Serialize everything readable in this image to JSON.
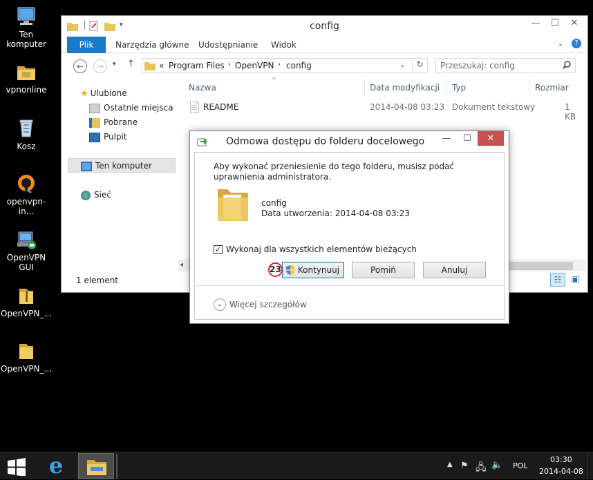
{
  "desktop": {
    "icons": [
      {
        "label": "Ten komputer"
      },
      {
        "label": "vpnonline"
      },
      {
        "label": "Kosz"
      },
      {
        "label": "openvpn-in..."
      },
      {
        "label": "OpenVPN GUI"
      },
      {
        "label": "OpenVPN_..."
      },
      {
        "label": "OpenVPN_..."
      }
    ]
  },
  "explorer": {
    "title": "config",
    "ribbon_tabs": [
      "Plik",
      "Narzędzia główne",
      "Udostępnianie",
      "Widok"
    ],
    "address": {
      "prefix": "«",
      "parts": [
        "Program Files",
        "OpenVPN",
        "config"
      ]
    },
    "search_placeholder": "Przeszukaj: config",
    "nav": {
      "favorites": "Ulubione",
      "fav_items": [
        "Ostatnie miejsca",
        "Pobrane",
        "Pulpit"
      ],
      "this_pc": "Ten komputer",
      "network": "Sieć"
    },
    "columns": [
      "Nazwa",
      "Data modyfikacji",
      "Typ",
      "Rozmiar"
    ],
    "files": [
      {
        "name": "README",
        "modified": "2014-04-08 03:23",
        "type": "Dokument tekstowy",
        "size": "1 KB"
      }
    ],
    "status": "1 element"
  },
  "dialog": {
    "title": "Odmowa dostępu do folderu docelowego",
    "message": "Aby wykonać przeniesienie do tego folderu, musisz podać uprawnienia administratora.",
    "item_name": "config",
    "item_date": "Data utworzenia: 2014-04-08 03:23",
    "checkbox_label": "Wykonaj dla wszystkich elementów bieżących",
    "checkbox_checked": true,
    "step_badge": "23",
    "buttons": {
      "continue": "Kontynuuj",
      "skip": "Pomiń",
      "cancel": "Anuluj"
    },
    "more_details": "Więcej szczegółów"
  },
  "taskbar": {
    "language": "POL",
    "time": "03:30",
    "date": "2014-04-08"
  },
  "colors": {
    "accent": "#1979ca",
    "folder": "#e8c35a",
    "badge": "#d9262b"
  }
}
